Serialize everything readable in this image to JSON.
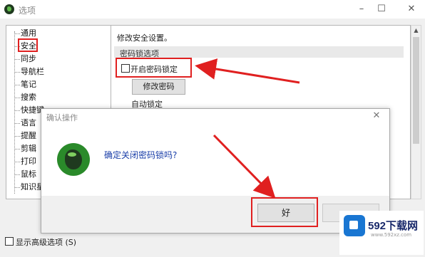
{
  "window": {
    "title": "选项",
    "minimize": "–",
    "maximize": "☐",
    "close": "✕"
  },
  "tree": {
    "items": [
      {
        "label": "通用"
      },
      {
        "label": "安全"
      },
      {
        "label": "同步"
      },
      {
        "label": "导航栏"
      },
      {
        "label": "笔记"
      },
      {
        "label": "搜索"
      },
      {
        "label": "快捷键"
      },
      {
        "label": "语言"
      },
      {
        "label": "提醒"
      },
      {
        "label": "剪辑"
      },
      {
        "label": "打印"
      },
      {
        "label": "鼠标"
      },
      {
        "label": "知识星球"
      }
    ],
    "selected": "安全"
  },
  "security": {
    "heading": "修改安全设置。",
    "group": "密码锁选项",
    "enable_lock_label": "开启密码锁定",
    "enable_lock_checked": false,
    "change_password_button": "修改密码",
    "auto_lock_label": "自动锁定"
  },
  "advanced": {
    "label": "显示高级选项 (S)",
    "checked": false
  },
  "dialog": {
    "title": "确认操作",
    "close": "✕",
    "message": "确定关闭密码锁吗?",
    "ok_button": "好"
  },
  "watermark": {
    "text": "592下载网",
    "url": "www.592xz.com"
  },
  "colors": {
    "highlight": "#e02020",
    "message": "#1a3ea8",
    "brand": "#2a8a2a"
  }
}
